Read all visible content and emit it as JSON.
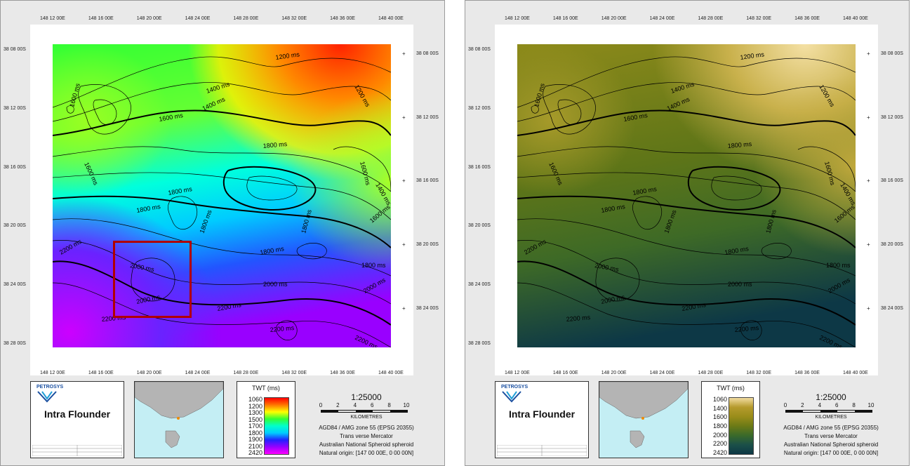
{
  "map_left": {
    "top_ticks": [
      "148 12 00E",
      "148 16 00E",
      "148 20 00E",
      "148 24 00E",
      "148 28 00E",
      "148 32 00E",
      "148 36 00E",
      "148 40 00E"
    ],
    "bottom_ticks": [
      "148 12 00E",
      "148 16 00E",
      "148 20 00E",
      "148 24 00E",
      "148 28 00E",
      "148 32 00E",
      "148 36 00E",
      "148 40 00E"
    ],
    "left_ticks": [
      "38 08 00S",
      "38 12 00S",
      "38 16 00S",
      "38 20 00S",
      "38 24 00S",
      "38 28 00S"
    ],
    "right_ticks": [
      "38 08 00S",
      "38 12 00S",
      "38 16 00S",
      "38 20 00S",
      "38 24 00S"
    ],
    "contour_labels": [
      {
        "text": "1200 ms"
      },
      {
        "text": "1400 ms"
      },
      {
        "text": "1200 ms"
      },
      {
        "text": "1400 ms"
      },
      {
        "text": "1600 ms"
      },
      {
        "text": "1600 ms"
      },
      {
        "text": "1600 ms"
      },
      {
        "text": "1800 ms"
      },
      {
        "text": "1800 ms"
      },
      {
        "text": "1600 ms"
      },
      {
        "text": "1800 ms"
      },
      {
        "text": "1400 ms"
      },
      {
        "text": "1600 ms"
      },
      {
        "text": "1800 ms"
      },
      {
        "text": "1800 ms"
      },
      {
        "text": "2200 ms"
      },
      {
        "text": "2000 ms"
      },
      {
        "text": "2000 ms"
      },
      {
        "text": "2000 ms"
      },
      {
        "text": "2200 ms"
      },
      {
        "text": "2200 ms"
      },
      {
        "text": "2000 ms"
      },
      {
        "text": "2200 ms"
      },
      {
        "text": "2200 ms"
      },
      {
        "text": "1800 ms"
      },
      {
        "text": "1800 ms"
      }
    ]
  },
  "title_block": {
    "logo": "PETROSYS",
    "title": "Intra Flounder"
  },
  "legend_left": {
    "title": "TWT (ms)",
    "labels": [
      "1060",
      "1200",
      "1300",
      "1500",
      "1700",
      "1800",
      "1900",
      "2100",
      "2420"
    ],
    "colors": [
      "#ff0000",
      "#ff7700",
      "#ffff00",
      "#33ff33",
      "#00ffcc",
      "#00ccff",
      "#2222ff",
      "#9900ff",
      "#ff00ff"
    ]
  },
  "legend_right": {
    "title": "TWT (ms)",
    "labels": [
      "1060",
      "1400",
      "1600",
      "1800",
      "2000",
      "2200",
      "2420"
    ],
    "colors": [
      "#f2dca0",
      "#b59a2c",
      "#9a8d1a",
      "#6c7a16",
      "#3a6a2a",
      "#1b5048",
      "#0d3846"
    ]
  },
  "scale": {
    "ratio": "1:25000",
    "numbers": [
      "0",
      "2",
      "4",
      "6",
      "8",
      "10"
    ],
    "unit": "KILOMETRES",
    "proj_lines": [
      "AGD84 / AMG zone 55 (EPSG 20355)",
      "Trans verse Mercator",
      "Australian National Spheroid spheroid",
      "Natural origin: [147 00 00E, 0 00 00N]"
    ]
  }
}
